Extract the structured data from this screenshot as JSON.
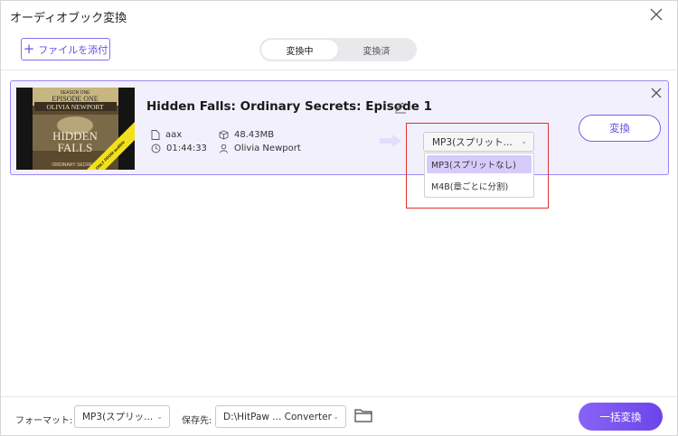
{
  "window": {
    "title": "オーディオブック変換"
  },
  "toolbar": {
    "add_label": "ファイルを添付"
  },
  "tabs": {
    "converting": "変換中",
    "converted": "変換済"
  },
  "item": {
    "title": "Hidden Falls: Ordinary Secrets: Episode 1",
    "format": "aax",
    "size": "48.43MB",
    "duration": "01:44:33",
    "author": "Olivia Newport",
    "cover": {
      "line1": "SEASON ONE",
      "line2": "EPISODE ONE",
      "author": "OLIVIA NEWPORT",
      "title1": "HIDDEN",
      "title2": "FALLS",
      "footer": "ORDINARY SECRETS",
      "badge": "ONLY FROM audible"
    },
    "output_format": "MP3(スプリット...",
    "format_options": [
      "MP3(スプリットなし)",
      "M4B(章ごとに分割)"
    ],
    "convert_label": "変換"
  },
  "footer": {
    "format_label": "フォーマット:",
    "format_value": "MP3(スプリッ...",
    "save_label": "保存先:",
    "save_value": "D:\\HitPaw ... Converter",
    "bulk_label": "一括変換"
  },
  "colors": {
    "accent": "#6b4ee6",
    "highlight": "#e23030",
    "card_bg": "#f3f0fe"
  }
}
